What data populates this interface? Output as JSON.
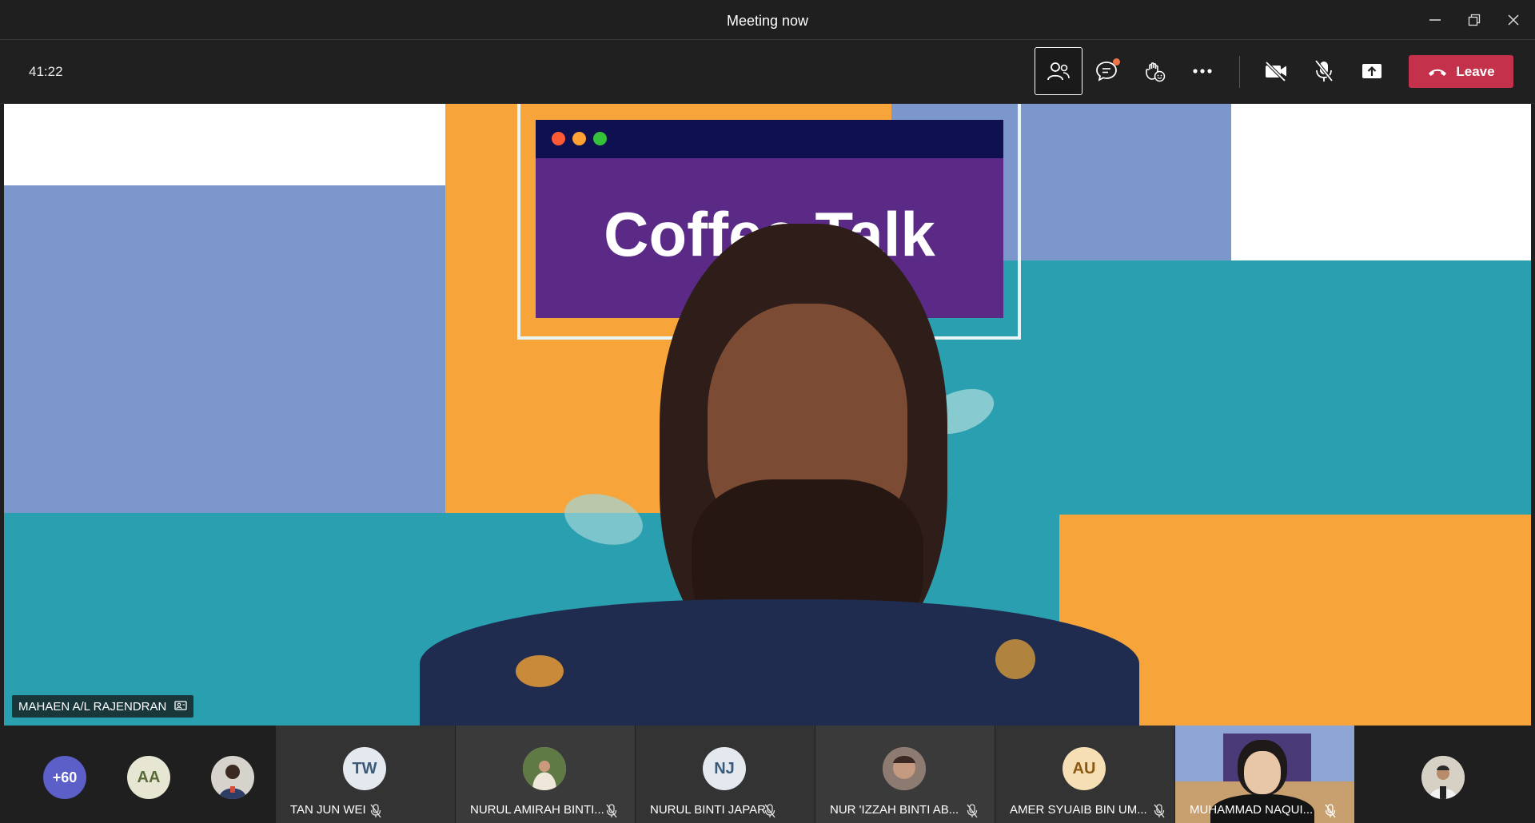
{
  "window": {
    "title": "Meeting now"
  },
  "toolbar": {
    "timer": "41:22",
    "leave_label": "Leave",
    "icons": [
      "people-icon",
      "chat-icon",
      "reactions-icon",
      "more-icon",
      "camera-off-icon",
      "mic-off-icon",
      "share-screen-icon",
      "phone-hangup-icon"
    ]
  },
  "stage": {
    "banner_text": "Coffee Talk",
    "speaker_name": "MAHAEN A/L RAJENDRAN"
  },
  "strip": {
    "overflow_count": "+60",
    "avatars": [
      {
        "initials": "AA",
        "bg": "#e6e6d2",
        "fg": "#5a6b3a"
      }
    ],
    "tiles": [
      {
        "name": "TAN JUN WEI",
        "initials": "TW",
        "bg": "#e3e9ef",
        "fg": "#3b5a78",
        "muted": true
      },
      {
        "name": "NURUL AMIRAH BINTI...",
        "initials": "",
        "bg": "#d9c9b4",
        "fg": "#444",
        "muted": true
      },
      {
        "name": "NURUL BINTI JAPAR",
        "initials": "NJ",
        "bg": "#e3e9ef",
        "fg": "#3b5a78",
        "muted": true
      },
      {
        "name": "NUR 'IZZAH BINTI AB...",
        "initials": "",
        "bg": "#a38a7a",
        "fg": "#fff",
        "muted": true
      },
      {
        "name": "AMER SYUAIB BIN UM...",
        "initials": "AU",
        "bg": "#f6dfb5",
        "fg": "#8a5a12",
        "muted": true
      },
      {
        "name": "MUHAMMAD NAQUI...",
        "initials": "",
        "bg": "#4a3a78",
        "fg": "#fff",
        "muted": true
      }
    ]
  },
  "colors": {
    "leave": "#c4314b",
    "accent_purple": "#6264a7",
    "orange": "#f7a53b",
    "teal": "#2a9fb0",
    "blue": "#7b97cc"
  }
}
